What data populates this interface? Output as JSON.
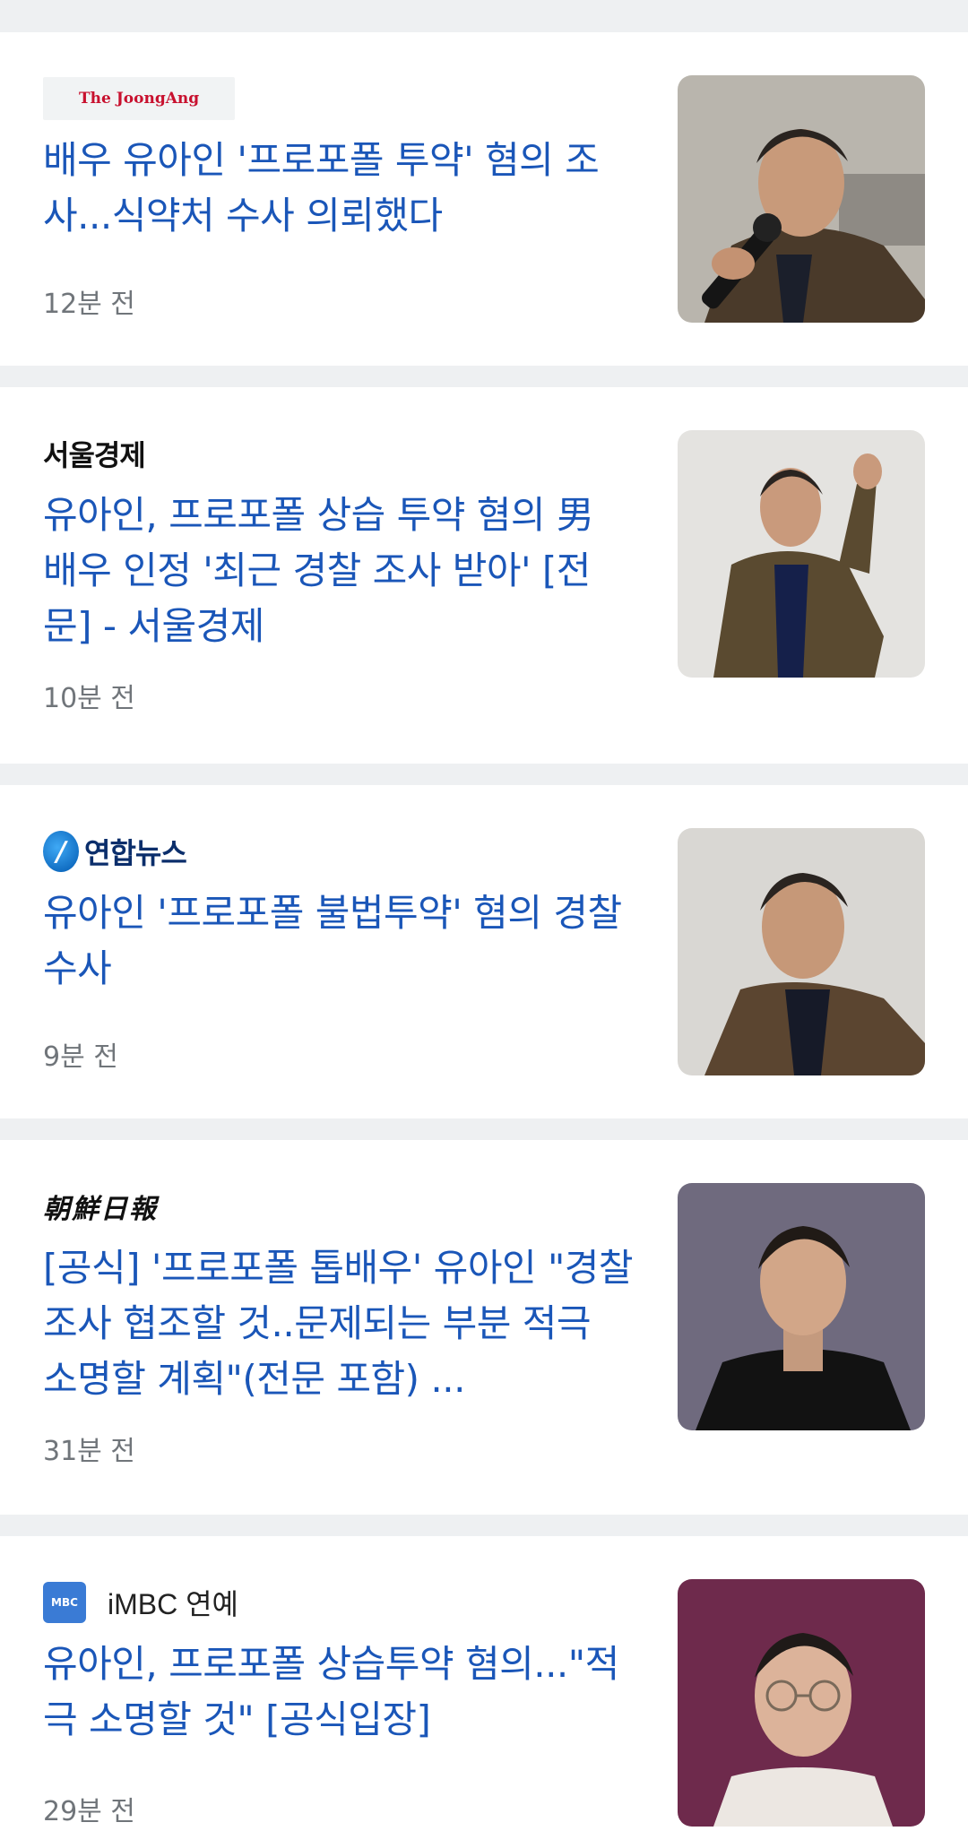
{
  "articles": [
    {
      "source": "The JoongAng",
      "headline": "배우 유아인 '프로포폴 투약' 혐의 조사...식약처 수사 의뢰했다",
      "time": "12분 전",
      "thumb_bg": "#b9b5ad"
    },
    {
      "source": "서울경제",
      "headline": "유아인, 프로포폴 상습 투약 혐의 男 배우 인정 '최근 경찰 조사 받아' [전문] - 서울경제",
      "time": "10분 전",
      "thumb_bg": "#e4e3e0"
    },
    {
      "source": "연합뉴스",
      "headline": "유아인 '프로포폴 불법투약' 혐의 경찰 수사",
      "time": "9분 전",
      "thumb_bg": "#d9d7d3"
    },
    {
      "source": "朝鮮日報",
      "headline": "[공식] '프로포폴 톱배우' 유아인 \"경찰 조사 협조할 것..문제되는 부분 적극 소명할 계획\"(전문 포함) ...",
      "time": "31분 전",
      "thumb_bg": "#6f6a7e"
    },
    {
      "source": "iMBC 연예",
      "headline": "유아인, 프로포폴 상습투약 혐의...\"적극 소명할 것\" [공식입장]",
      "time": "29분 전",
      "thumb_bg": "#6e2a4c"
    }
  ],
  "imbc_icon_text": "MBC"
}
